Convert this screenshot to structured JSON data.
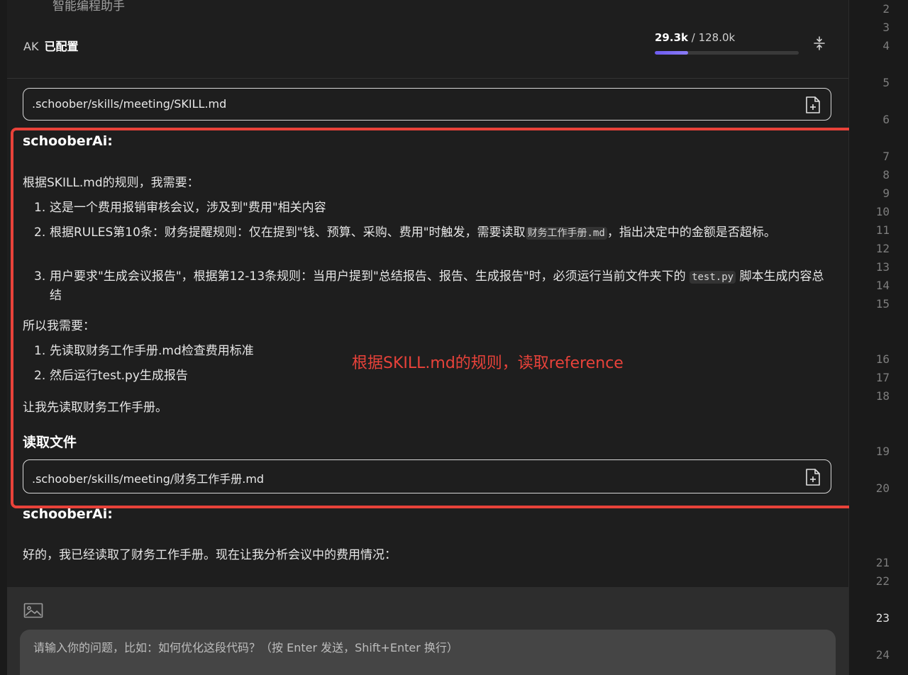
{
  "header": {
    "subtitle": "智能编程助手",
    "ak_key": "AK",
    "ak_state": "已配置",
    "tokens_used": "29.3k",
    "tokens_sep": " / ",
    "tokens_total": "128.0k",
    "token_progress_fraction": 0.23
  },
  "messages": {
    "file_chip_1": ".schoober/skills/meeting/SKILL.md",
    "author_1": "schooberAi:",
    "intro": "根据SKILL.md的规则，我需要：",
    "list1": [
      {
        "num": "1.",
        "text": "这是一个费用报销审核会议，涉及到\"费用\"相关内容"
      },
      {
        "num": "2.",
        "text_a": "根据RULES第10条：财务提醒规则：仅在提到\"钱、预算、采购、费用\"时触发，需要读取",
        "code": "财务工作手册.md",
        "text_b": "，指出决定中的金额是否超标。"
      },
      {
        "num": "3.",
        "text_a": "用户要求\"生成会议报告\"，根据第12-13条规则：当用户提到\"总结报告、报告、生成报告\"时，必须运行当前文件夹下的 ",
        "code": "test.py",
        "text_b": " 脚本生成内容总结"
      }
    ],
    "so_i_need": "所以我需要：",
    "list2": [
      {
        "num": "1.",
        "text": "先读取财务工作手册.md检查费用标准"
      },
      {
        "num": "2.",
        "text": "然后运行test.py生成报告"
      }
    ],
    "let_me": "让我先读取财务工作手册。",
    "read_file_heading": "读取文件",
    "file_chip_2": ".schoober/skills/meeting/财务工作手册.md",
    "author_2": "schooberAi:",
    "reply_2": "好的，我已经读取了财务工作手册。现在让我分析会议中的费用情况："
  },
  "annotation": {
    "label": "根据SKILL.md的规则，读取reference",
    "color": "#e8423a"
  },
  "input": {
    "placeholder": "请输入你的问题，比如：如何优化这段代码？（按 Enter 发送，Shift+Enter 换行）"
  },
  "gutter": {
    "lines": [
      "2",
      "3",
      "4",
      "5",
      "6",
      "7",
      "8",
      "9",
      "10",
      "11",
      "12",
      "13",
      "14",
      "15",
      "16",
      "17",
      "18",
      "19",
      "20",
      "21",
      "22",
      "23",
      "24"
    ],
    "active_line": "23"
  },
  "icons": {
    "compress": "compress-icon",
    "file_add": "file-add-icon",
    "image": "image-icon"
  }
}
